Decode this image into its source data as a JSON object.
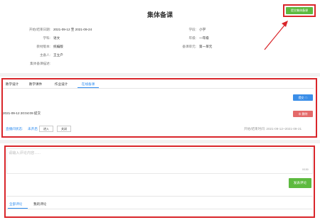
{
  "header": {
    "title": "集体备课",
    "top_button": "提交集体备课"
  },
  "info": {
    "left": [
      {
        "label": "开始/结束日期:",
        "value": "2021-09-12 至 2021-09-24"
      },
      {
        "label": "学科:",
        "value": "语文"
      },
      {
        "label": "教材版本:",
        "value": "统编版"
      },
      {
        "label": "主备人:",
        "value": "王立户"
      },
      {
        "label": "集体备课描述:",
        "value": ""
      }
    ],
    "right": [
      {
        "label": "学段:",
        "value": "小学"
      },
      {
        "label": "年级:",
        "value": "一年级"
      },
      {
        "label": "备课单元:",
        "value": "第一单元"
      }
    ]
  },
  "tabs": {
    "items": [
      "教学设计",
      "教学课件",
      "作业设计",
      "在线备课"
    ],
    "active_index": 3
  },
  "tab_content": {
    "submit_button": "提交 ☁",
    "submit_time": "2021-09-12 20:04:09 提交",
    "delete_button": "⊗ 删除",
    "live_label": "直播间状态:",
    "live_status": "未开启",
    "enter_button": "进入",
    "close_button": "关闭",
    "time_range": "开始/结束时间: 2021-09-12~2021-09-21"
  },
  "comment": {
    "placeholder": "请输入评论内容......",
    "counter": "0/150",
    "publish_button": "发表评论",
    "tabs": [
      "全部评论",
      "我的评论"
    ],
    "active_tab": 0
  }
}
